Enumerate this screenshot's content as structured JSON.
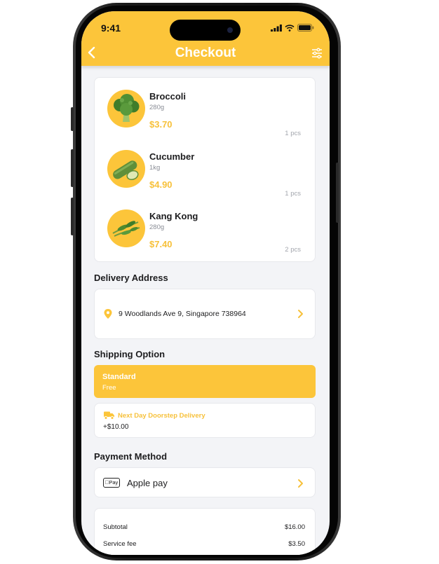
{
  "status": {
    "time": "9:41"
  },
  "header": {
    "title": "Checkout"
  },
  "cart": {
    "items": [
      {
        "name": "Broccoli",
        "weight": "280g",
        "price": "$3.70",
        "qty": "1 pcs"
      },
      {
        "name": "Cucumber",
        "weight": "1kg",
        "price": "$4.90",
        "qty": "1 pcs"
      },
      {
        "name": "Kang Kong",
        "weight": "280g",
        "price": "$7.40",
        "qty": "2 pcs"
      }
    ]
  },
  "delivery": {
    "heading": "Delivery Address",
    "address": "9 Woodlands Ave 9, Singapore 738964"
  },
  "shipping": {
    "heading": "Shipping Option",
    "options": [
      {
        "label": "Standard",
        "detail": "Free",
        "selected": true
      },
      {
        "label": "Next Day Doorstep Delivery",
        "detail": "+$10.00",
        "selected": false
      }
    ]
  },
  "payment": {
    "heading": "Payment Method",
    "badge": "Pay",
    "method": "Apple pay"
  },
  "summary": {
    "rows": [
      {
        "label": "Subtotal",
        "value": "$16.00"
      },
      {
        "label": "Service fee",
        "value": "$3.50"
      }
    ]
  },
  "colors": {
    "accent": "#fcc53a",
    "price": "#f7c13b",
    "background": "#f3f4f7"
  },
  "icons": [
    "back-chevron-icon",
    "filter-sliders-icon",
    "location-pin-icon",
    "chevron-right-icon",
    "delivery-truck-icon",
    "signal-icon",
    "wifi-icon",
    "battery-icon"
  ]
}
